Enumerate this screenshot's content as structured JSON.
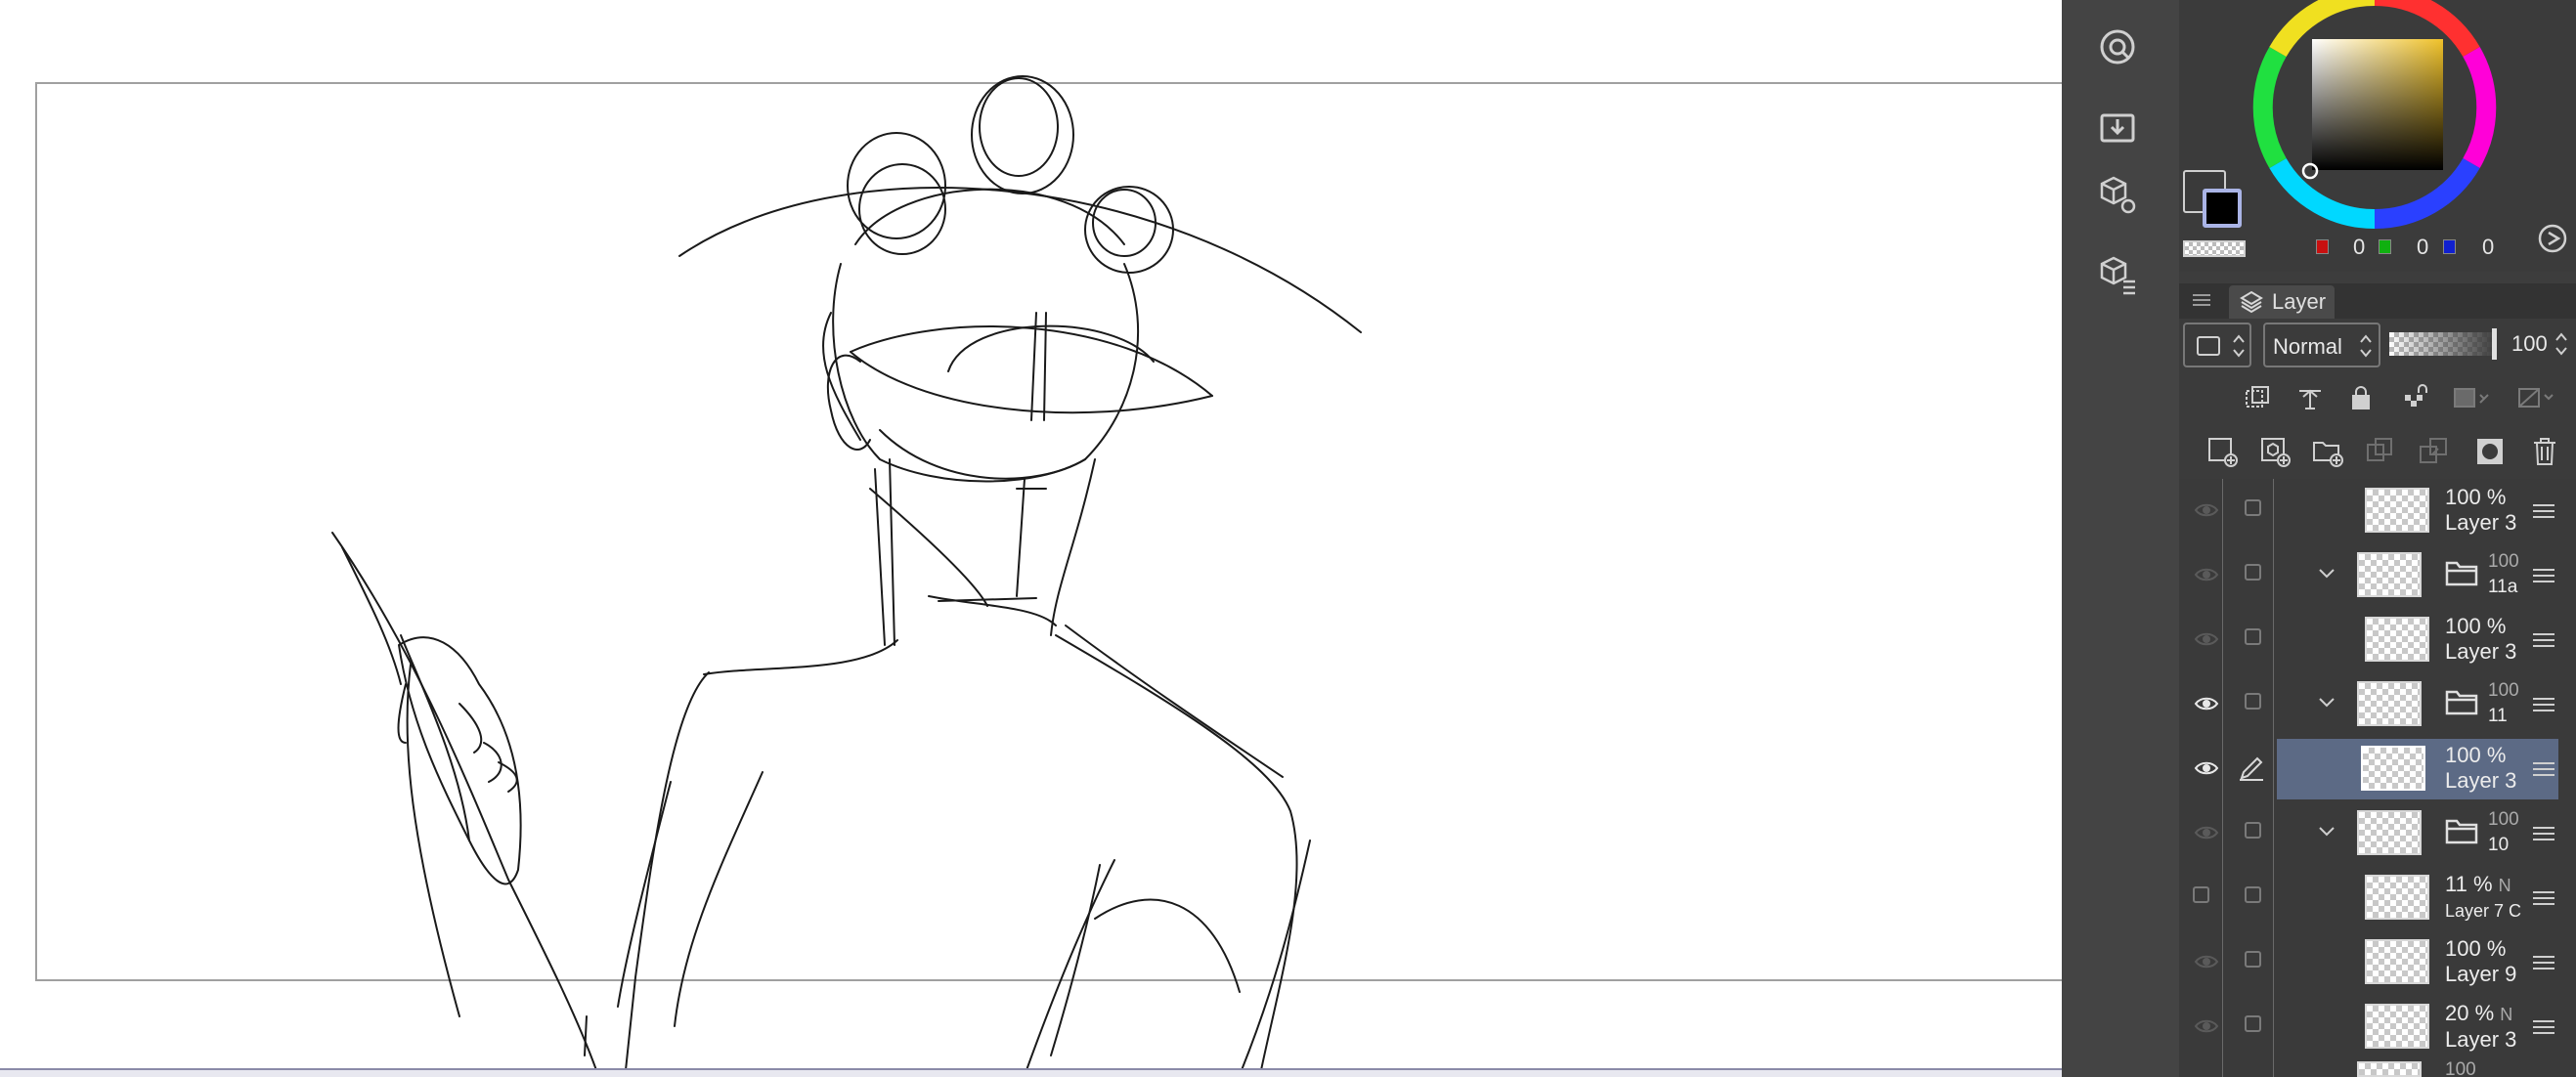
{
  "icons": {
    "tool_strip": [
      "navigator-icon",
      "import-icon",
      "3d-settings-icon",
      "3d-layers-icon"
    ],
    "layer_actions": [
      "new-raster-layer-icon",
      "new-3d-layer-icon",
      "new-folder-icon",
      "copy-layer-icon",
      "merge-layer-icon",
      "mask-icon",
      "delete-icon"
    ]
  },
  "color": {
    "r": "0",
    "g": "0",
    "b": "0",
    "main_color": "#3a3a3a",
    "sub_color": "#000000",
    "square_hue": "#f0c22a"
  },
  "layer_panel": {
    "tab_label": "Layer",
    "blend_mode": "Normal",
    "opacity_value": "100",
    "layers": [
      {
        "opacity": "100 %",
        "name": "Layer 3",
        "kind": "layer",
        "visible": false,
        "selected": false
      },
      {
        "opacity": "100",
        "name": "11a",
        "kind": "folder",
        "visible": false,
        "selected": false
      },
      {
        "opacity": "100 %",
        "name": "Layer 3",
        "kind": "layer",
        "visible": false,
        "selected": false
      },
      {
        "opacity": "100",
        "name": "11",
        "kind": "folder",
        "visible": true,
        "selected": false
      },
      {
        "opacity": "100 %",
        "name": "Layer 3",
        "kind": "layer",
        "visible": true,
        "selected": true
      },
      {
        "opacity": "100",
        "name": "10",
        "kind": "folder",
        "visible": false,
        "selected": false
      },
      {
        "opacity": "11 %",
        "name": "Layer 7 C",
        "kind": "layer",
        "visible": false,
        "selected": false,
        "extra": "N"
      },
      {
        "opacity": "100 %",
        "name": "Layer 9",
        "kind": "layer",
        "visible": false,
        "selected": false
      },
      {
        "opacity": "20 %",
        "name": "Layer 3",
        "kind": "layer",
        "visible": false,
        "selected": false,
        "extra": "N"
      },
      {
        "opacity": "100",
        "name": "",
        "kind": "folder",
        "visible": false,
        "selected": false
      }
    ]
  }
}
